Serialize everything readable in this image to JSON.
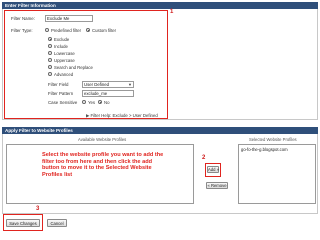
{
  "filter_info": {
    "header": "Enter Filter Information",
    "filter_name_label": "Filter Name:",
    "filter_name_value": "Exclude Me",
    "filter_type_label": "Filter Type:",
    "type_predefined": "Predefined filter",
    "type_custom": "Custom filter",
    "custom_options": [
      "Exclude",
      "Include",
      "Lowercase",
      "Uppercase",
      "Search and Replace",
      "Advanced"
    ],
    "filter_field_label": "Filter Field",
    "filter_field_value": "User Defined",
    "filter_pattern_label": "Filter Pattern",
    "filter_pattern_value": "exclude_me",
    "case_sensitive_label": "Case Sensitive",
    "case_yes": "Yes",
    "case_no": "No",
    "help_text": "Filter Help: Exclude > User Defined",
    "callout_number": "1"
  },
  "apply": {
    "header": "Apply Filter to Website Profiles",
    "available_label": "Available Website Profiles",
    "selected_label": "Selected Website Profiles",
    "instruction": "Select the website profile you want to add the filter too from here and then click the add button to move it to the Selected Website Profiles list",
    "add_button": "Add »",
    "remove_button": "« Remove",
    "selected_profiles": [
      "go-fo-the-g.blogspot.com"
    ],
    "callout_number": "2"
  },
  "footer": {
    "save_button": "Save Changes",
    "cancel_button": "Cancel",
    "callout_number": "3"
  },
  "colors": {
    "header_bg": "#2f4f7a",
    "callout": "#e0241f"
  }
}
